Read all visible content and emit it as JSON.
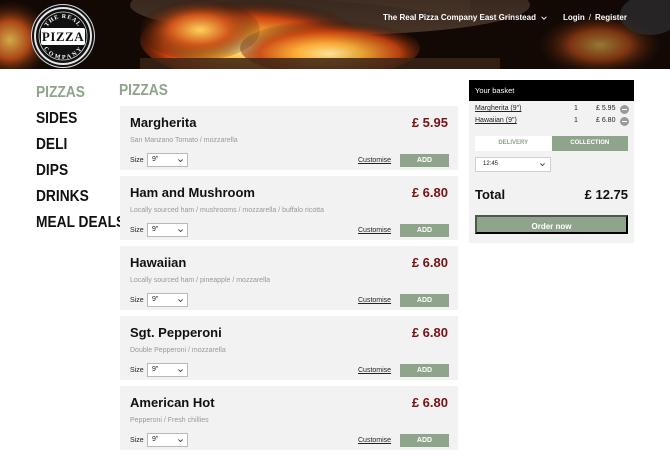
{
  "header": {
    "logo_top": "THE REAL",
    "logo_word": "PIZZA",
    "logo_bottom": "COMPANY",
    "location": "The Real Pizza Company East Grinstead",
    "login": "Login",
    "separator": "/",
    "register": "Register"
  },
  "categories": [
    {
      "label": "PIZZAS",
      "active": true
    },
    {
      "label": "SIDES",
      "active": false
    },
    {
      "label": "DELI",
      "active": false
    },
    {
      "label": "DIPS",
      "active": false
    },
    {
      "label": "DRINKS",
      "active": false
    },
    {
      "label": "MEAL DEALS",
      "active": false
    }
  ],
  "section_title": "PIZZAS",
  "items": [
    {
      "name": "Margherita",
      "price": "£ 5.95",
      "desc": "San Manzano Tomato / mozzarella",
      "size_label": "Size",
      "size": "9\"",
      "customise": "Customise",
      "add": "ADD"
    },
    {
      "name": "Ham and Mushroom",
      "price": "£ 6.80",
      "desc": "Locally sourced ham / mushrooms / mozzarella / buffalo ricotta",
      "size_label": "Size",
      "size": "9\"",
      "customise": "Customise",
      "add": "ADD"
    },
    {
      "name": "Hawaiian",
      "price": "£ 6.80",
      "desc": "Locally sourced ham / pineapple / mozzarella",
      "size_label": "Size",
      "size": "9\"",
      "customise": "Customise",
      "add": "ADD"
    },
    {
      "name": "Sgt. Pepperoni",
      "price": "£ 6.80",
      "desc": "Double Pepperoni / mozzarella",
      "size_label": "Size",
      "size": "9\"",
      "customise": "Customise",
      "add": "ADD"
    },
    {
      "name": "American Hot",
      "price": "£ 6.80",
      "desc": "Pepperoni / Fresh chillies",
      "size_label": "Size",
      "size": "9\"",
      "customise": "Customise",
      "add": "ADD"
    }
  ],
  "basket": {
    "title": "Your basket",
    "rows": [
      {
        "name": "Margherita (9\")",
        "qty": "1",
        "price": "£ 5.95"
      },
      {
        "name": "Hawaiian (9\")",
        "qty": "1",
        "price": "£ 6.80"
      }
    ],
    "tab_delivery": "DELIVERY",
    "tab_collection": "COLLECTION",
    "selected_tab": "collection",
    "time": "12:45",
    "total_label": "Total",
    "total_value": "£ 12.75",
    "order_label": "Order now"
  },
  "colors": {
    "accent_green": "#8fa58b",
    "price_red": "#7a1114",
    "header_bg": "#0d0704"
  }
}
